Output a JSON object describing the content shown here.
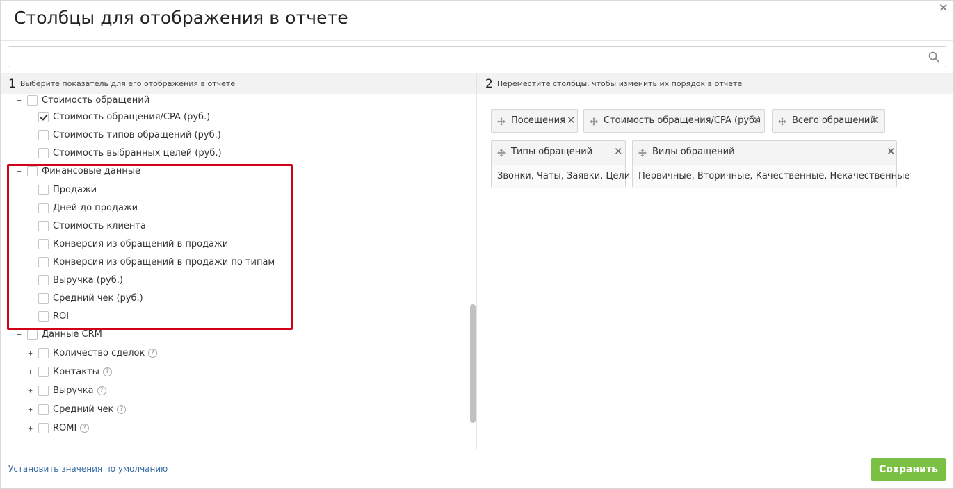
{
  "dialog": {
    "title": "Столбцы для отображения в отчете",
    "close": "✕"
  },
  "search": {
    "value": "",
    "placeholder": ""
  },
  "left_panel": {
    "step": "1",
    "hint": "Выберите показатель для его отображения в отчете",
    "tree": [
      {
        "label": "Стоимость обращений",
        "checked": false,
        "toggle": "−",
        "level": 0,
        "help": false
      },
      {
        "label": "Стоимость обращения/CPA (руб.)",
        "checked": true,
        "toggle": "",
        "level": 1,
        "help": false
      },
      {
        "label": "Стоимость типов обращений (руб.)",
        "checked": false,
        "toggle": "",
        "level": 1,
        "help": false
      },
      {
        "label": "Стоимость выбранных целей (руб.)",
        "checked": false,
        "toggle": "",
        "level": 1,
        "help": false
      },
      {
        "label": "Финансовые данные",
        "checked": false,
        "toggle": "−",
        "level": 0,
        "help": false
      },
      {
        "label": "Продажи",
        "checked": false,
        "toggle": "",
        "level": 1,
        "help": false
      },
      {
        "label": "Дней до продажи",
        "checked": false,
        "toggle": "",
        "level": 1,
        "help": false
      },
      {
        "label": "Стоимость клиента",
        "checked": false,
        "toggle": "",
        "level": 1,
        "help": false
      },
      {
        "label": "Конверсия из обращений в продажи",
        "checked": false,
        "toggle": "",
        "level": 1,
        "help": false
      },
      {
        "label": "Конверсия из обращений в продажи по типам",
        "checked": false,
        "toggle": "",
        "level": 1,
        "help": false
      },
      {
        "label": "Выручка (руб.)",
        "checked": false,
        "toggle": "",
        "level": 1,
        "help": false
      },
      {
        "label": "Средний чек (руб.)",
        "checked": false,
        "toggle": "",
        "level": 1,
        "help": false
      },
      {
        "label": "ROI",
        "checked": false,
        "toggle": "",
        "level": 1,
        "help": false
      },
      {
        "label": "Данные CRM",
        "checked": false,
        "toggle": "−",
        "level": 0,
        "help": false
      },
      {
        "label": "Количество сделок",
        "checked": false,
        "toggle": "+",
        "level": 1,
        "help": true
      },
      {
        "label": "Контакты",
        "checked": false,
        "toggle": "+",
        "level": 1,
        "help": true
      },
      {
        "label": "Выручка",
        "checked": false,
        "toggle": "+",
        "level": 1,
        "help": true
      },
      {
        "label": "Средний чек",
        "checked": false,
        "toggle": "+",
        "level": 1,
        "help": true
      },
      {
        "label": "ROMI",
        "checked": false,
        "toggle": "+",
        "level": 1,
        "help": true
      }
    ]
  },
  "right_panel": {
    "step": "2",
    "hint": "Переместите столбцы, чтобы изменить их порядок в отчете",
    "chips": [
      {
        "label": "Посещения",
        "sub": ""
      },
      {
        "label": "Стоимость обращения/CPA (руб.)",
        "sub": ""
      },
      {
        "label": "Всего обращений",
        "sub": ""
      },
      {
        "label": "Типы обращений",
        "sub": "Звонки, Чаты, Заявки, Цели"
      },
      {
        "label": "Виды обращений",
        "sub": "Первичные, Вторичные, Качественные, Некачественные"
      }
    ]
  },
  "footer": {
    "reset_label": "Установить значения по умолчанию",
    "save_label": "Сохранить"
  },
  "colors": {
    "accent": "#7ac143",
    "highlight": "#d0021b",
    "link": "#3b6ea5"
  },
  "icons": {
    "search": "search-icon",
    "move": "move-icon",
    "close": "close-icon",
    "help": "help-icon"
  }
}
